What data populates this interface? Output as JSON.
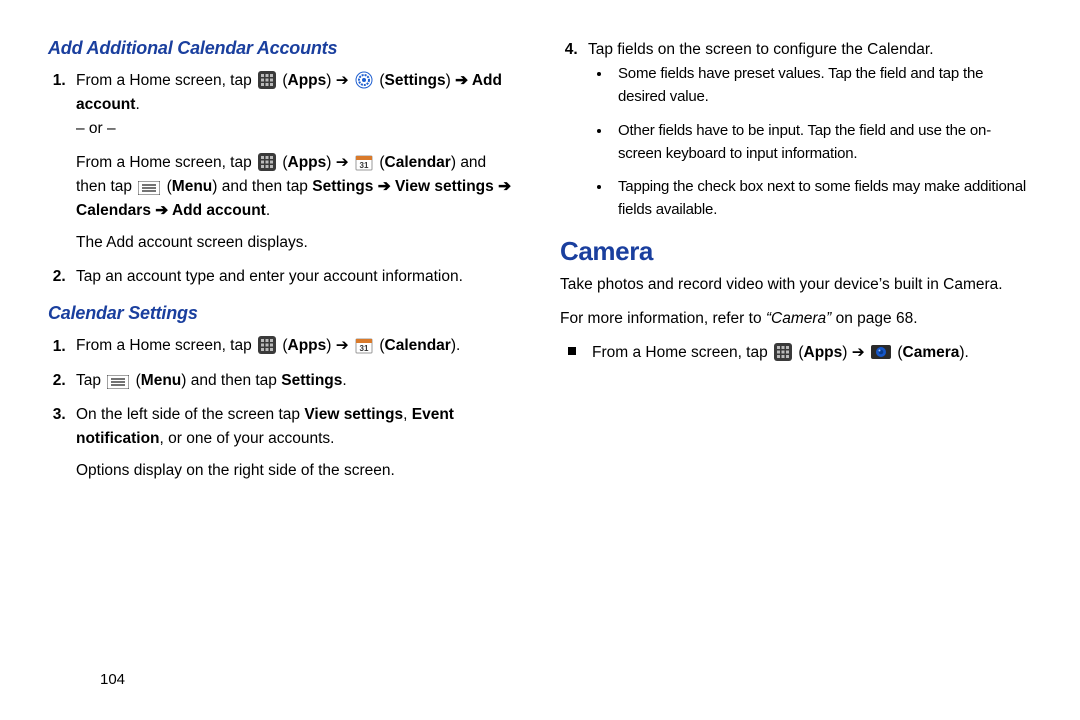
{
  "page_number": "104",
  "left": {
    "h1": "Add Additional Calendar Accounts",
    "s1_pre": "From a Home screen, tap ",
    "apps": "Apps",
    "settings": "Settings",
    "arrow_add_account": " Add account",
    "or": "– or –",
    "s1b_pre": "From a Home screen, tap ",
    "calendar": "Calendar",
    "s1b_mid1": "and then tap ",
    "menu": "Menu",
    "s1b_mid2": " and then tap ",
    "s1b_bold1": "Settings ➔ View settings ➔ Calendars ➔ Add account",
    "s1_after": "The Add account screen displays.",
    "s2": "Tap an account type and enter your account information.",
    "h2": "Calendar Settings",
    "cs1_pre": "From a Home screen, tap ",
    "cs2_pre": "Tap ",
    "cs2_mid": " and then tap ",
    "cs2_bold": "Settings",
    "cs3_pre": "On the left side of the screen tap ",
    "cs3_b1": "View settings",
    "cs3_mid": ", ",
    "cs3_b2": "Event notification",
    "cs3_post": ", or one of your accounts.",
    "cs3_after": "Options display on the right side of the screen."
  },
  "right": {
    "s4_lead": "Tap fields on the screen to configure the Calendar.",
    "b1": "Some fields have preset values. Tap the field and tap the desired value.",
    "b2": "Other fields have to be input. Tap the field and use the on-screen keyboard to input information.",
    "b3": "Tapping the check box next to some fields may make additional fields available.",
    "h_camera": "Camera",
    "cam_p1": "Take photos and record video with your device’s built in Camera.",
    "cam_p2a": "For more information, refer to ",
    "cam_p2q": "“Camera”",
    "cam_p2b": " on page 68.",
    "cam_li_pre": "From a Home screen, tap ",
    "camera_label": "Camera"
  }
}
